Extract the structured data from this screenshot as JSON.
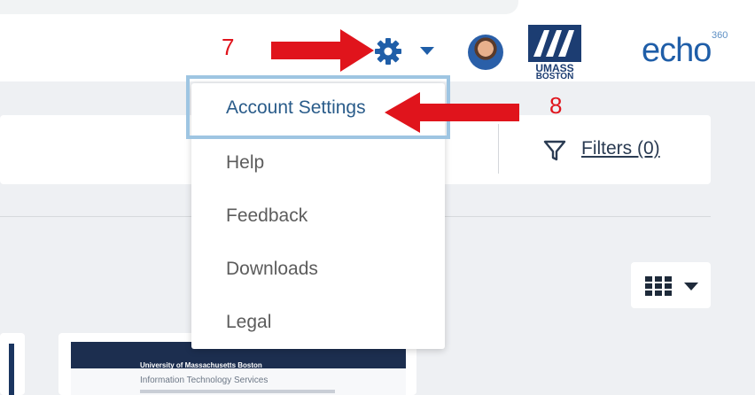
{
  "annotations": {
    "step_7": "7",
    "step_8": "8"
  },
  "header": {
    "settings_icon": "gear-icon",
    "settings_caret": "chevron-down-icon",
    "university_logo": {
      "line1": "UMASS",
      "line2": "BOSTON"
    },
    "brand_logo": {
      "text": "echo",
      "sup": "360"
    }
  },
  "dropdown": {
    "items": [
      {
        "label": "Account Settings"
      },
      {
        "label": "Help"
      },
      {
        "label": "Feedback"
      },
      {
        "label": "Downloads"
      },
      {
        "label": "Legal"
      }
    ]
  },
  "toolbar": {
    "filters_label": "Filters (0)"
  },
  "thumbnail": {
    "title": "University of Massachusetts Boston",
    "heading": "Information Technology Services"
  },
  "colors": {
    "accent_blue": "#1f5ea8",
    "annotation_red": "#e0141c",
    "highlight_border": "#9ec5e2"
  }
}
